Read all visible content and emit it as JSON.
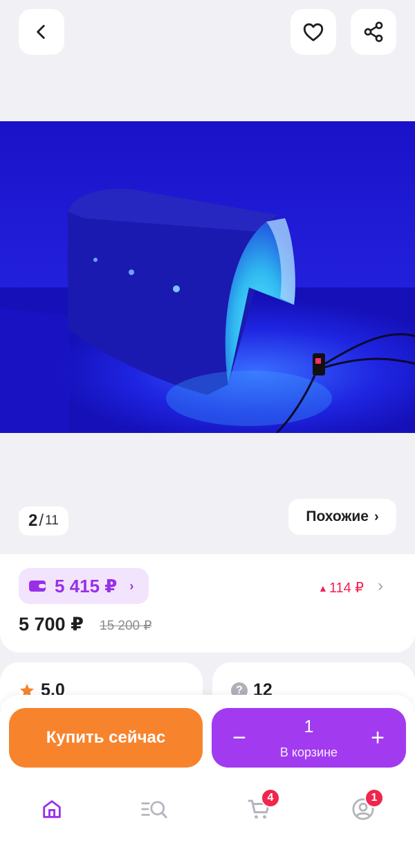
{
  "header": {
    "back_icon": "chevron-left-icon",
    "favorite_icon": "heart-icon",
    "share_icon": "share-icon"
  },
  "gallery": {
    "current": "2",
    "separator": "/",
    "total": "11",
    "similar_label": "Похожие",
    "similar_chevron": "›"
  },
  "price": {
    "wallet_price": "5 415 ₽",
    "wallet_chevron": "›",
    "change_arrow": "▲",
    "change_value": "114 ₽",
    "change_chevron": "›",
    "current": "5 700 ₽",
    "old": "15 200 ₽",
    "accent_color": "#9a2fe8",
    "change_color": "#f02050"
  },
  "info": {
    "rating": "5.0",
    "questions_icon_glyph": "?",
    "questions": "12"
  },
  "actions": {
    "buy_label": "Купить сейчас",
    "minus": "−",
    "plus": "+",
    "quantity": "1",
    "in_cart_label": "В корзине",
    "buy_color": "#f7842d",
    "cart_color": "#a23bf0"
  },
  "tabs": {
    "home_icon": "home-icon",
    "catalog_icon": "catalog-search-icon",
    "cart_icon": "cart-icon",
    "cart_badge": "4",
    "profile_icon": "profile-icon",
    "profile_badge": "1",
    "active_color": "#9a2fe8"
  }
}
